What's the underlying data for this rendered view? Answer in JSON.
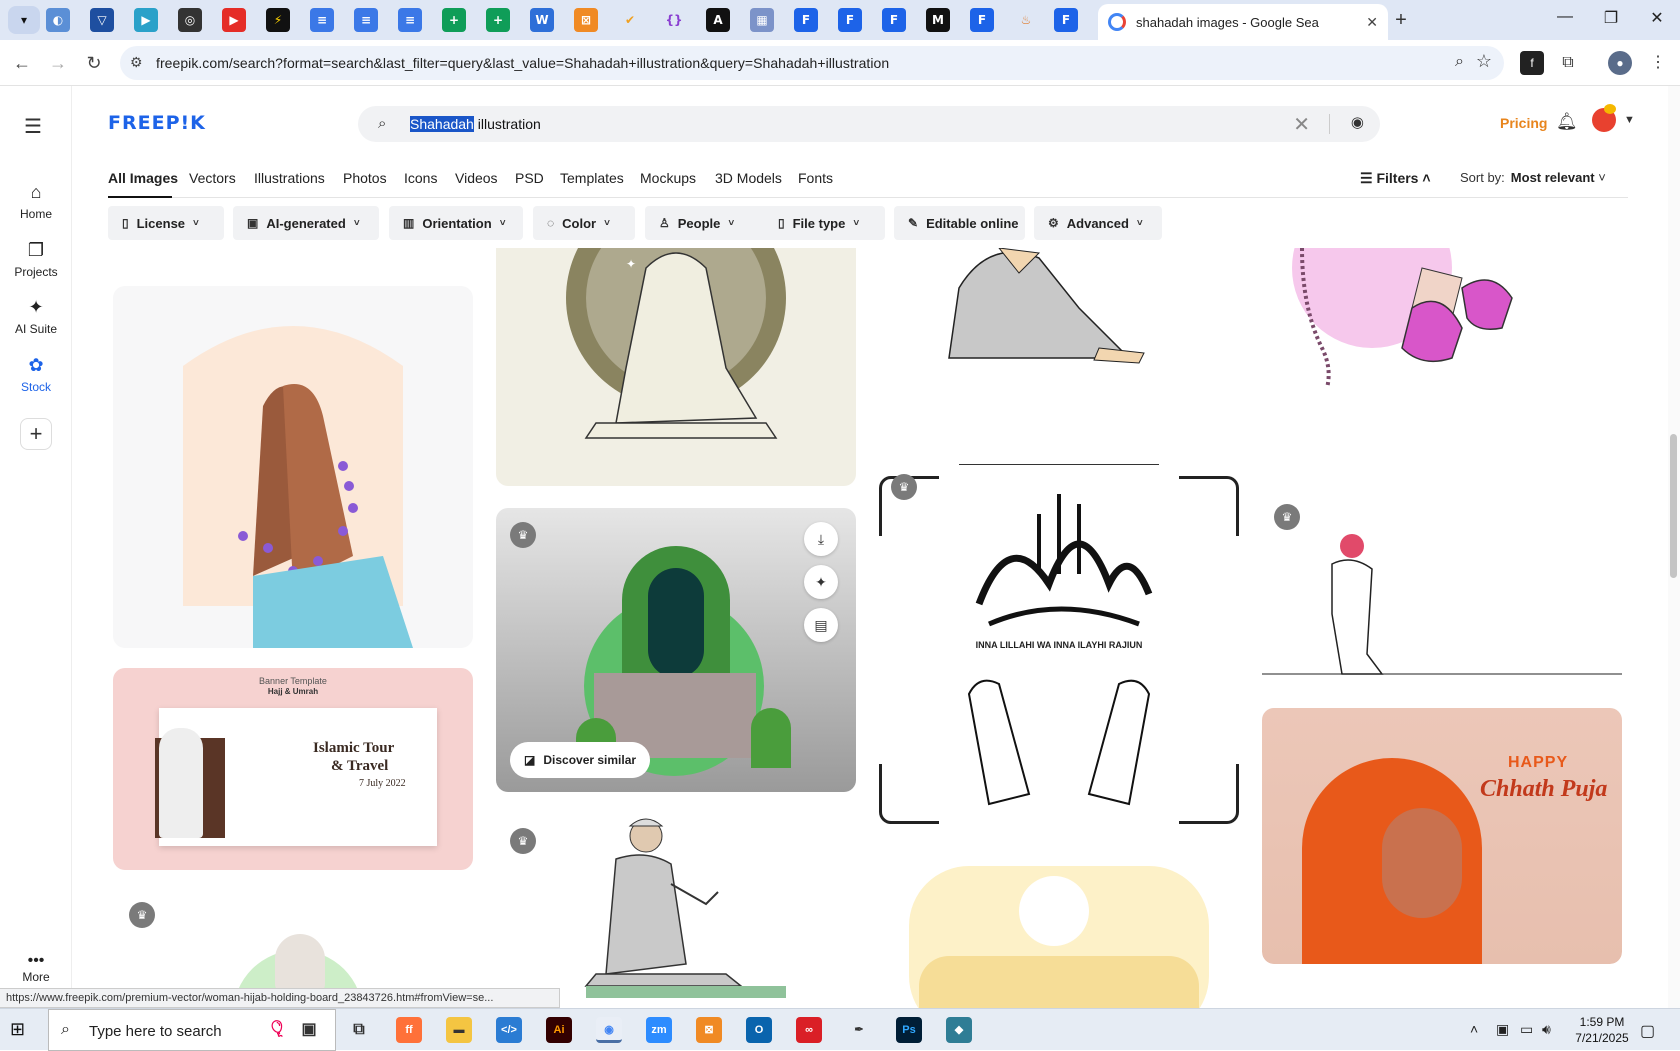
{
  "browser": {
    "active_tab": {
      "title": "shahadah images - Google Sea"
    },
    "url": "freepik.com/search?format=search&last_filter=query&last_value=Shahadah+illustration&query=Shahadah+illustration",
    "status_url": "https://www.freepik.com/premium-vector/woman-hijab-holding-board_23843726.htm#fromView=se..."
  },
  "sidebar": {
    "items": [
      {
        "label": "Home",
        "icon": "home-icon"
      },
      {
        "label": "Projects",
        "icon": "projects-icon"
      },
      {
        "label": "AI Suite",
        "icon": "sparkle-icon"
      },
      {
        "label": "Stock",
        "icon": "stock-icon"
      }
    ],
    "more_label": "More"
  },
  "header": {
    "logo": "FREEP!K",
    "search": {
      "query_selected": "Shahadah",
      "query_rest": " illustration"
    },
    "pricing_label": "Pricing"
  },
  "category_tabs": [
    "All Images",
    "Vectors",
    "Illustrations",
    "Photos",
    "Icons",
    "Videos",
    "PSD",
    "Templates",
    "Mockups",
    "3D Models",
    "Fonts"
  ],
  "filters": {
    "filters_label": "Filters",
    "sort_label": "Sort by:",
    "sort_value": "Most relevant",
    "chips": [
      "License",
      "AI-generated",
      "Orientation",
      "Color",
      "People",
      "File type",
      "Editable online",
      "Advanced"
    ]
  },
  "gallery": {
    "discover_label": "Discover similar",
    "banner": {
      "heading": "Banner Template",
      "subheading": "Hajj & Umrah",
      "title_line1": "Islamic Tour",
      "title_line2": "& Travel",
      "date": "7 July 2022"
    },
    "calligraphy_caption": "INNA LILLAHI WA INNA ILAYHI RAJIUN",
    "chhath": {
      "line1": "HAPPY",
      "line2": "Chhath Puja"
    }
  },
  "taskbar": {
    "search_placeholder": "Type here to search",
    "time": "1:59 PM",
    "date": "7/21/2025"
  },
  "colors": {
    "brand": "#1d63e8",
    "pricing": "#e8851d",
    "selection": "#1a56c8"
  }
}
